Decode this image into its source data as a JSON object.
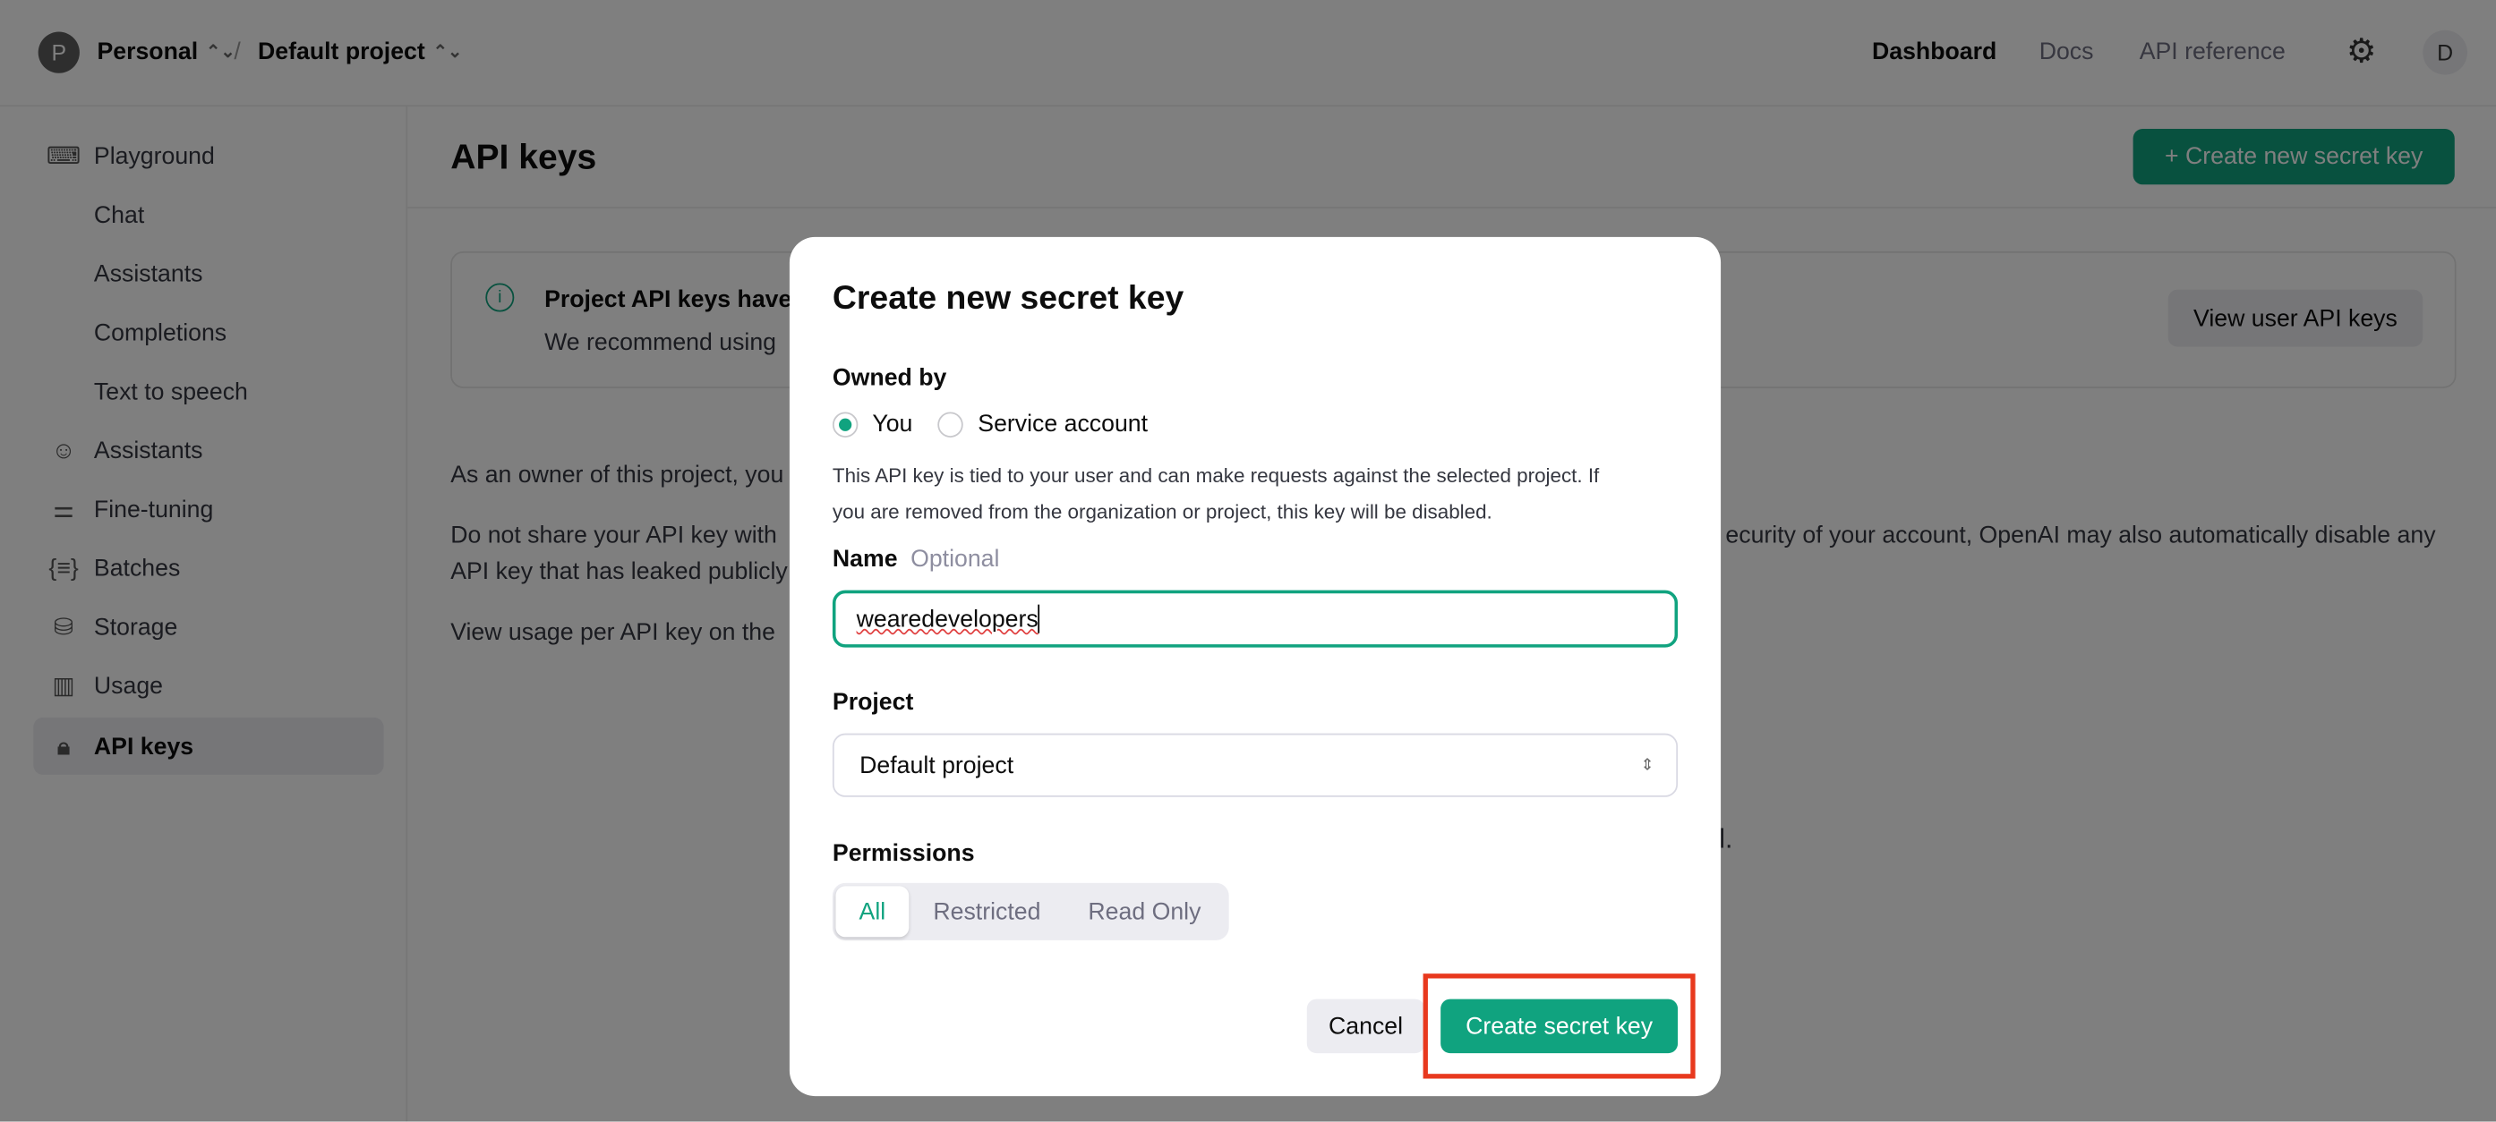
{
  "topbar": {
    "org_initial": "P",
    "org_name": "Personal",
    "separator": "/",
    "project_name": "Default project",
    "nav": [
      "Dashboard",
      "Docs",
      "API reference"
    ],
    "user_initial": "D"
  },
  "sidebar": {
    "items": [
      {
        "label": "Playground",
        "icon": "terminal-icon"
      },
      {
        "label": "Chat"
      },
      {
        "label": "Assistants"
      },
      {
        "label": "Completions"
      },
      {
        "label": "Text to speech"
      },
      {
        "label": "Assistants",
        "icon": "robot-icon"
      },
      {
        "label": "Fine-tuning",
        "icon": "sliders-icon"
      },
      {
        "label": "Batches",
        "icon": "braces-icon"
      },
      {
        "label": "Storage",
        "icon": "database-icon"
      },
      {
        "label": "Usage",
        "icon": "bar-chart-icon"
      },
      {
        "label": "API keys",
        "icon": "lock-icon",
        "active": true
      }
    ]
  },
  "main": {
    "title": "API keys",
    "create_button": "+ Create new secret key",
    "notice_title": "Project API keys have",
    "notice_body": "We recommend using",
    "view_user_keys": "View user API keys",
    "para1": "As an owner of this project, you",
    "para2_line1_left": "Do not share your API key with",
    "para2_line1_right": "ecurity of your account, OpenAI may also automatically disable any",
    "para2_line2": "API key that has leaked publicly",
    "para3": "View usage per API key on the",
    "fragment": "l."
  },
  "modal": {
    "title": "Create new secret key",
    "owned_by_label": "Owned by",
    "owner_options": [
      "You",
      "Service account"
    ],
    "owner_selected": "You",
    "owner_help_line1": "This API key is tied to your user and can make requests against the selected project. If",
    "owner_help_line2": "you are removed from the organization or project, this key will be disabled.",
    "name_label": "Name",
    "name_optional": "Optional",
    "name_value": "wearedevelopers",
    "project_label": "Project",
    "project_value": "Default project",
    "permissions_label": "Permissions",
    "permissions": [
      "All",
      "Restricted",
      "Read Only"
    ],
    "permissions_selected": "All",
    "cancel": "Cancel",
    "submit": "Create secret key"
  },
  "colors": {
    "accent": "#10a37f",
    "highlight": "#e8391e"
  }
}
